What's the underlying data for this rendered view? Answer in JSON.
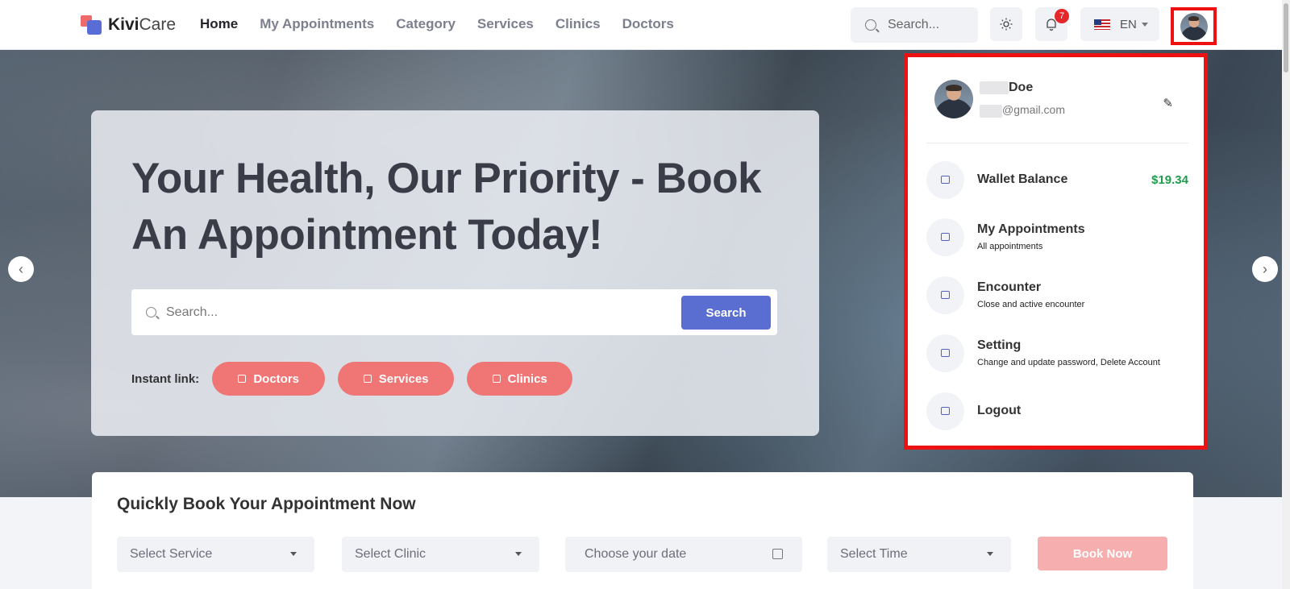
{
  "brand": {
    "name_bold": "Kivi",
    "name_rest": "Care"
  },
  "nav": [
    "Home",
    "My Appointments",
    "Category",
    "Services",
    "Clinics",
    "Doctors"
  ],
  "header": {
    "search_placeholder": "Search...",
    "notification_count": "7",
    "language": "EN"
  },
  "hero": {
    "title": "Your Health, Our Priority - Book An Appointment Today!",
    "search_placeholder": "Search...",
    "search_button": "Search",
    "instant_label": "Instant link:",
    "instant_links": [
      "Doctors",
      "Services",
      "Clinics"
    ],
    "prev_arrow": "‹",
    "next_arrow": "›"
  },
  "profile_menu": {
    "name_visible": "Doe",
    "email_visible": "@gmail.com",
    "edit_icon": "✎",
    "items": [
      {
        "title": "Wallet Balance",
        "subtitle": "",
        "value": "$19.34",
        "icon": "wallet-icon"
      },
      {
        "title": "My Appointments",
        "subtitle": "All appointments",
        "value": "",
        "icon": "calendar-icon"
      },
      {
        "title": "Encounter",
        "subtitle": "Close and active encounter",
        "value": "",
        "icon": "gauge-icon"
      },
      {
        "title": "Setting",
        "subtitle": "Change and update password, Delete Account",
        "value": "",
        "icon": "lock-icon"
      },
      {
        "title": "Logout",
        "subtitle": "",
        "value": "",
        "icon": "logout-icon"
      }
    ]
  },
  "booking": {
    "title": "Quickly Book Your Appointment Now",
    "service": "Select Service",
    "clinic": "Select Clinic",
    "date": "Choose your date",
    "time": "Select Time",
    "button": "Book Now"
  },
  "colors": {
    "primary": "#5a6dd1",
    "accent": "#f07575",
    "highlight_border": "#ee1111",
    "wallet_value": "#1f9d4c"
  }
}
